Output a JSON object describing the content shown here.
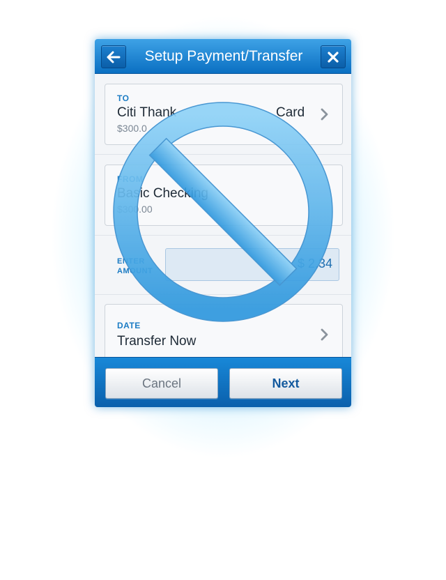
{
  "dialog": {
    "title": "Setup Payment/Transfer",
    "back_icon": "arrow-left-icon",
    "close_icon": "close-icon"
  },
  "to": {
    "label": "TO",
    "account": "Citi Thank",
    "account_end": "Card",
    "balance": "$300.0"
  },
  "from": {
    "label": "FROM",
    "account": "Basic Checking",
    "balance": "$300.00"
  },
  "amount": {
    "label_line1": "ENTER",
    "label_line2": "AMOUNT",
    "value": "$ 2.34"
  },
  "date": {
    "label": "DATE",
    "value": "Transfer Now"
  },
  "footer": {
    "cancel_label": "Cancel",
    "next_label": "Next"
  },
  "overlay": {
    "icon": "forbidden-icon",
    "color": "#4aaee8"
  }
}
